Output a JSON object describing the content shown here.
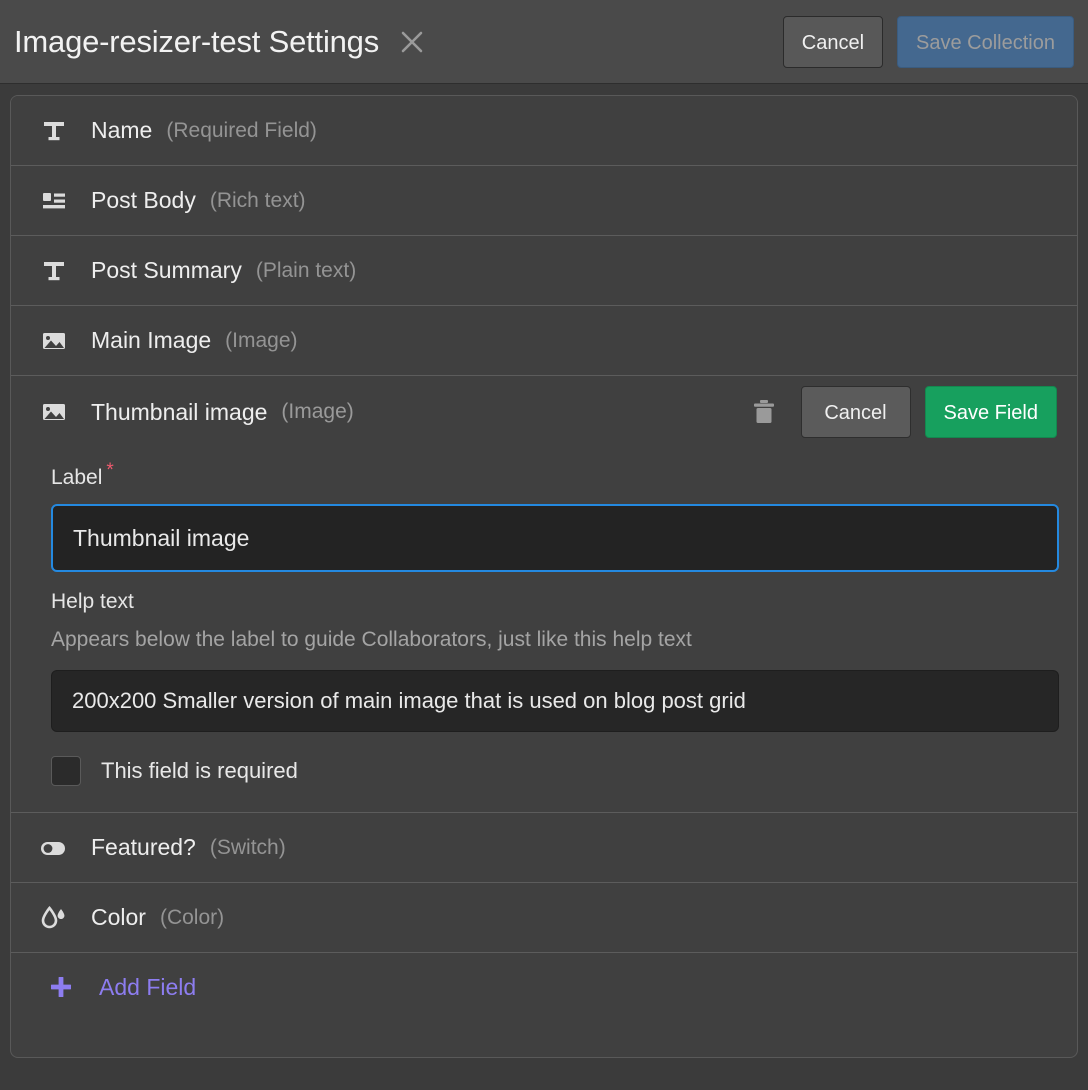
{
  "header": {
    "title": "Image-resizer-test Settings",
    "close_icon": "close-icon",
    "cancel_label": "Cancel",
    "save_collection_label": "Save Collection",
    "save_collection_color": "#44688f",
    "save_collection_disabled_text_color": "#9c9c9c"
  },
  "fields": [
    {
      "name": "Name",
      "type": "(Required Field)",
      "icon": "text-field-icon"
    },
    {
      "name": "Post Body",
      "type": "(Rich text)",
      "icon": "rich-text-icon"
    },
    {
      "name": "Post Summary",
      "type": "(Plain text)",
      "icon": "text-field-icon"
    },
    {
      "name": "Main Image",
      "type": "(Image)",
      "icon": "image-icon"
    }
  ],
  "expanded_field": {
    "name": "Thumbnail image",
    "type": "(Image)",
    "icon": "image-icon",
    "trash_icon": "trash-icon",
    "cancel_label": "Cancel",
    "save_label": "Save Field",
    "save_color": "#17a05e",
    "label_section": {
      "label": "Label",
      "required_marker": "*",
      "required_marker_color": "#f05a6e",
      "value": "Thumbnail image",
      "focus_border_color": "#2489e0"
    },
    "help_section": {
      "label": "Help text",
      "description": "Appears below the label to guide Collaborators, just like this help text",
      "value": "200x200 Smaller version of main image that is used on blog post grid"
    },
    "required_checkbox": {
      "label": "This field is required",
      "checked": false
    }
  },
  "fields_after": [
    {
      "name": "Featured?",
      "type": "(Switch)",
      "icon": "switch-icon"
    },
    {
      "name": "Color",
      "type": "(Color)",
      "icon": "color-droplet-icon"
    }
  ],
  "add_field": {
    "label": "Add Field",
    "icon": "plus-icon",
    "color": "#8d7df0"
  }
}
